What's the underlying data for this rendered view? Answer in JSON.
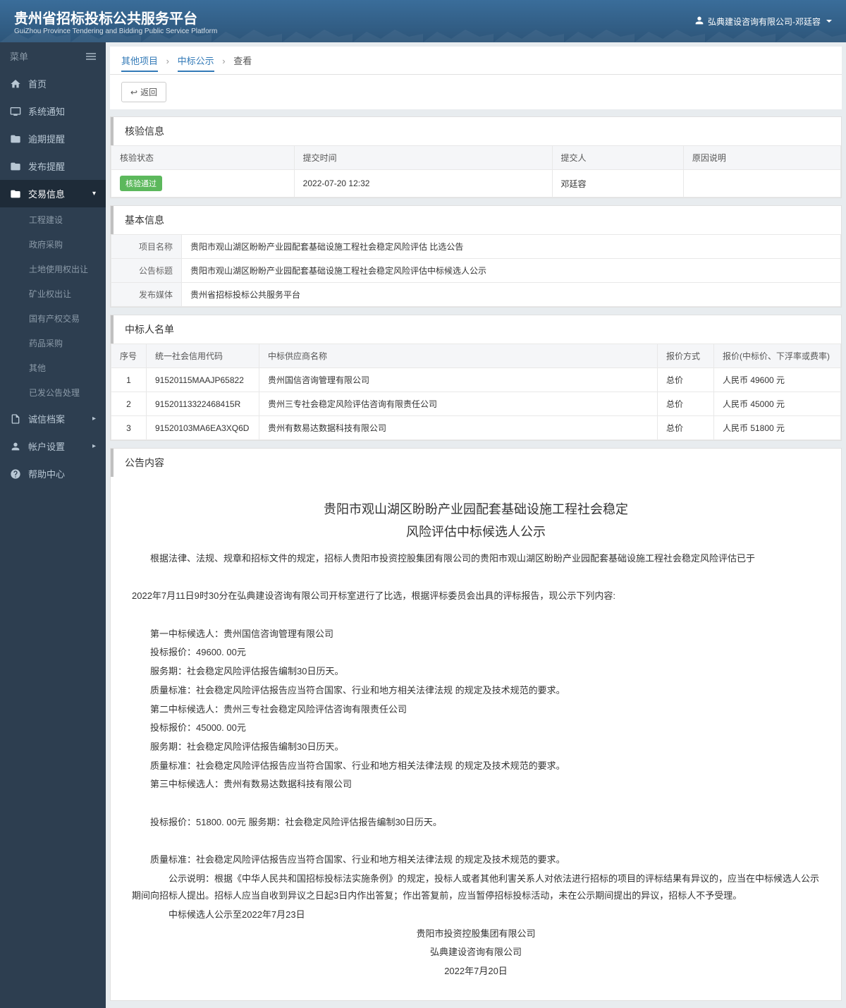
{
  "header": {
    "title": "贵州省招标投标公共服务平台",
    "subtitle": "GuiZhou Province Tendering and Bidding Public Service Platform",
    "user": "弘典建设咨询有限公司-邓廷容"
  },
  "sidebar": {
    "menu_label": "菜单",
    "items": [
      {
        "label": "首页",
        "icon": "home"
      },
      {
        "label": "系统通知",
        "icon": "monitor"
      },
      {
        "label": "逾期提醒",
        "icon": "folder"
      },
      {
        "label": "发布提醒",
        "icon": "folder"
      },
      {
        "label": "交易信息",
        "icon": "folder",
        "active": true,
        "expanded": true
      },
      {
        "label": "诚信档案",
        "icon": "doc"
      },
      {
        "label": "帐户设置",
        "icon": "user"
      },
      {
        "label": "帮助中心",
        "icon": "help"
      }
    ],
    "submenu": [
      "工程建设",
      "政府采购",
      "土地使用权出让",
      "矿业权出让",
      "国有产权交易",
      "药品采购",
      "其他",
      "已发公告处理"
    ]
  },
  "breadcrumb": [
    "其他项目",
    "中标公示",
    "查看"
  ],
  "back_label": "返回",
  "verify": {
    "title": "核验信息",
    "headers": [
      "核验状态",
      "提交时间",
      "提交人",
      "原因说明"
    ],
    "row": {
      "status": "核验通过",
      "time": "2022-07-20 12:32",
      "person": "邓廷容",
      "reason": ""
    }
  },
  "basic": {
    "title": "基本信息",
    "rows": [
      {
        "label": "项目名称",
        "value": "贵阳市观山湖区盼盼产业园配套基础设施工程社会稳定风险评估 比选公告"
      },
      {
        "label": "公告标题",
        "value": "贵阳市观山湖区盼盼产业园配套基础设施工程社会稳定风险评估中标候选人公示"
      },
      {
        "label": "发布媒体",
        "value": "贵州省招标投标公共服务平台"
      }
    ]
  },
  "winners": {
    "title": "中标人名单",
    "headers": [
      "序号",
      "统一社会信用代码",
      "中标供应商名称",
      "报价方式",
      "报价(中标价、下浮率或费率)"
    ],
    "rows": [
      {
        "no": "1",
        "code": "91520115MAAJP65822",
        "name": "贵州国信咨询管理有限公司",
        "method": "总价",
        "price": "人民币 49600 元"
      },
      {
        "no": "2",
        "code": "91520113322468415R",
        "name": "贵州三专社会稳定风险评估咨询有限责任公司",
        "method": "总价",
        "price": "人民币 45000 元"
      },
      {
        "no": "3",
        "code": "91520103MA6EA3XQ6D",
        "name": "贵州有数易达数据科技有限公司",
        "method": "总价",
        "price": "人民币 51800 元"
      }
    ]
  },
  "announce": {
    "section_title": "公告内容",
    "h1": "贵阳市观山湖区盼盼产业园配套基础设施工程社会稳定",
    "h2": "风险评估中标候选人公示",
    "p1": "根据法律、法规、规章和招标文件的规定，招标人贵阳市投资控股集团有限公司的贵阳市观山湖区盼盼产业园配套基础设施工程社会稳定风险评估已于",
    "p2": "2022年7月11日9时30分在弘典建设咨询有限公司开标室进行了比选，根据评标委员会出具的评标报告，现公示下列内容:",
    "c1_name": "第一中标候选人：贵州国信咨询管理有限公司",
    "c1_price": "投标报价：49600. 00元",
    "c1_period": "服务期：社会稳定风险评估报告编制30日历天。",
    "c1_quality": "质量标准：社会稳定风险评估报告应当符合国家、行业和地方相关法律法规 的规定及技术规范的要求。",
    "c2_name": "第二中标候选人：贵州三专社会稳定风险评估咨询有限责任公司",
    "c2_price": "投标报价：45000. 00元",
    "c2_period": "服务期：社会稳定风险评估报告编制30日历天。",
    "c2_quality": "质量标准：社会稳定风险评估报告应当符合国家、行业和地方相关法律法规 的规定及技术规范的要求。",
    "c3_name": "第三中标候选人：贵州有数易达数据科技有限公司",
    "c3_price": "投标报价：51800. 00元 服务期：社会稳定风险评估报告编制30日历天。",
    "c3_quality": "质量标准：社会稳定风险评估报告应当符合国家、行业和地方相关法律法规 的规定及技术规范的要求。",
    "note": "公示说明：根据《中华人民共和国招标投标法实施条例》的规定，投标人或者其他利害关系人对依法进行招标的项目的评标结果有异议的，应当在中标候选人公示期间向招标人提出。招标人应当自收到异议之日起3日内作出答复；作出答复前，应当暂停招标投标活动，未在公示期间提出的异议，招标人不予受理。",
    "until": "中标候选人公示至2022年7月23日",
    "sig1": "贵阳市投资控股集团有限公司",
    "sig2": "弘典建设咨询有限公司",
    "sig3": "2022年7月20日"
  }
}
